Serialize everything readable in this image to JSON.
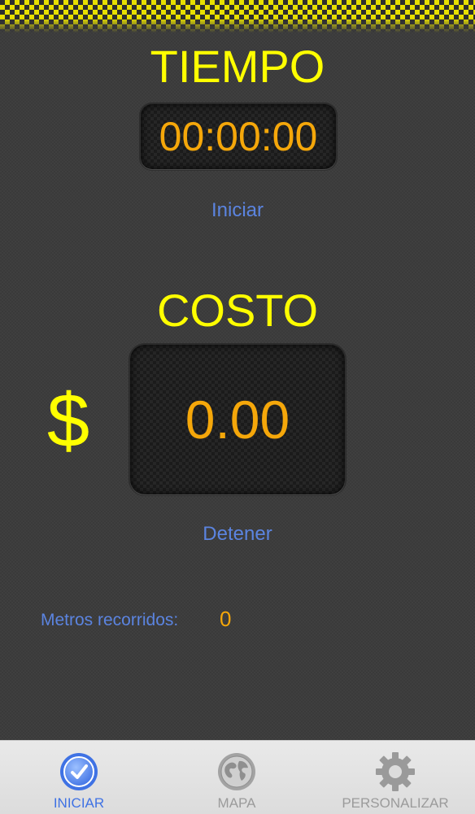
{
  "colors": {
    "accent_yellow": "#ffff00",
    "digit_orange": "#f5a70a",
    "link_blue": "#5b84e0",
    "tab_active": "#3f72e4",
    "tab_inactive": "#9b9b9b"
  },
  "timer": {
    "heading": "TIEMPO",
    "value": "00:00:00",
    "start_label": "Iniciar"
  },
  "cost": {
    "heading": "COSTO",
    "currency": "$",
    "value": "0.00",
    "stop_label": "Detener"
  },
  "distance": {
    "label": "Metros recorridos:",
    "value": "0"
  },
  "tabs": [
    {
      "label": "INICIAR",
      "icon": "checkmark-circle-icon",
      "active": true
    },
    {
      "label": "MAPA",
      "icon": "globe-icon",
      "active": false
    },
    {
      "label": "PERSONALIZAR",
      "icon": "gear-icon",
      "active": false
    }
  ]
}
